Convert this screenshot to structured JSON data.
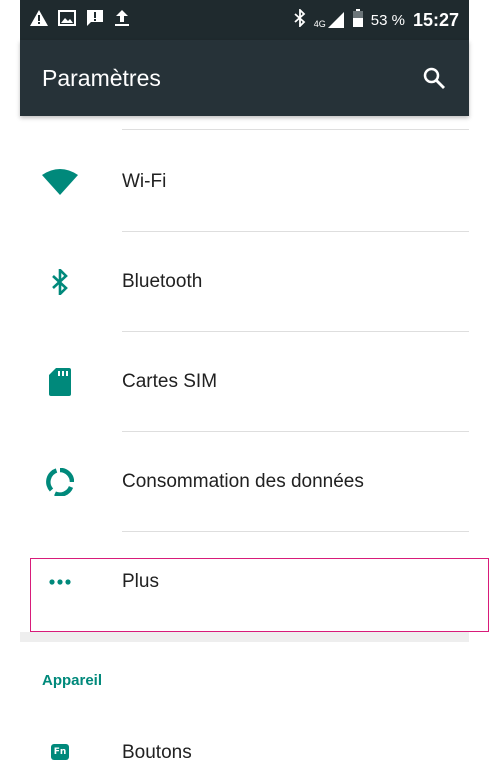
{
  "colors": {
    "accent": "#00897b",
    "appbar": "#263238",
    "statusbar": "#1f2a2e",
    "highlight": "#d81b7a"
  },
  "status_bar": {
    "icons_left": [
      "warning-icon",
      "image-icon",
      "message-alert-icon",
      "upload-icon"
    ],
    "icons_right": [
      "bluetooth-icon",
      "4g-signal-icon",
      "battery-icon"
    ],
    "network": "4G",
    "battery_percent": "53 %",
    "time": "15:27"
  },
  "app_bar": {
    "title": "Paramètres",
    "search_icon": "search-icon"
  },
  "items": [
    {
      "label": "Wi-Fi",
      "icon": "wifi-icon"
    },
    {
      "label": "Bluetooth",
      "icon": "bluetooth-icon"
    },
    {
      "label": "Cartes SIM",
      "icon": "sim-card-icon"
    },
    {
      "label": "Consommation des données",
      "icon": "data-usage-icon"
    },
    {
      "label": "Plus",
      "icon": "more-icon"
    }
  ],
  "section": {
    "header": "Appareil"
  },
  "device_items": [
    {
      "label": "Boutons",
      "icon": "fn-key-icon",
      "badge": "Fn"
    }
  ]
}
